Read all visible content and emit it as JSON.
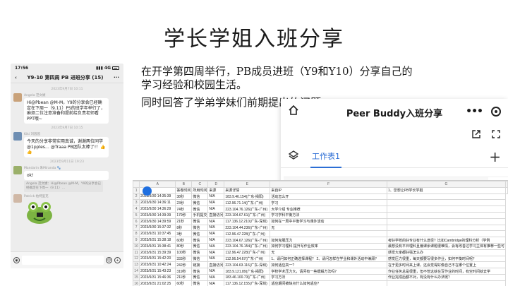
{
  "slide": {
    "title": "学长学姐入班分享",
    "paragraphs": [
      "在开学第四周举行，PB成员进班（Y9和Y10）分享自己的学习经验和校园生活。",
      "同时回答了学弟学妹们前期提出的问题"
    ]
  },
  "phone": {
    "time": "17:56",
    "signal": "4G",
    "chat_title": "Y9-10 第四周 PB 进班分享 (15)",
    "messages": [
      {
        "type": "time",
        "text": "2023年9月7日 10:11"
      },
      {
        "type": "msg",
        "sender": "Angela 范文婕",
        "avatar_color": "#c9a27a",
        "text": "Hi@Pbean @M-M，Y9的分享会已经确定在下周一（9.11）PS的班学年举行了，麻烦二位注意准备和提前给负责老师看PPT哦~"
      },
      {
        "type": "time",
        "text": "2023年9月7日 10:15"
      },
      {
        "type": "msg",
        "sender": "Kiki 刘茵茵",
        "avatar_color": "#6f8fb3",
        "text": "今天的分享非常实用真诚，谢谢两位同学@1pples… @Traaa PB团队太棒了!！👍👍"
      },
      {
        "type": "time",
        "text": "2023年9月11日 19:23"
      },
      {
        "type": "msg",
        "sender": "Mandarin 朱Miranda 🐾",
        "avatar_color": "#9bb06a",
        "text": "ok!",
        "quote": "Angela 范文婕：Hi@Pbean @M-M，Y9的分享会已经确定在下周一（9.11）…"
      },
      {
        "type": "sticker",
        "sender": "Patrick 帕特里克",
        "avatar_color": "#d0b8a6"
      }
    ],
    "input_placeholder": ""
  },
  "app": {
    "title": "Peer Buddy入班分享",
    "more_icon": "more-horizontal-icon",
    "sheet_tab": "工作表1",
    "accent": "#2c6ed5"
  },
  "sheet": {
    "columns": [
      "A",
      "B",
      "C",
      "D",
      "E",
      "F",
      "G"
    ],
    "header_row": [
      "",
      "答卷时间",
      "所用时间",
      "来源",
      "来源详情",
      "来自IP",
      "1、您想让PB学长学姐"
    ],
    "rows": [
      [
        "2",
        "2023/9/30 14:35:39",
        "38秒",
        "微信",
        "N/A",
        "183.9.46.154(广东-揭阳)",
        "活动怎么开"
      ],
      [
        "3",
        "2023/9/30 14:36:11",
        "23秒",
        "微信",
        "N/A",
        "112.96.71.14(广东-广州)",
        "学习"
      ],
      [
        "4",
        "2023/9/30 14:36:29",
        "74秒",
        "微信",
        "N/A",
        "223.104.76.126(广东-广州)",
        "大学介绍 专业推荐"
      ],
      [
        "5",
        "2023/9/30 14:39:39",
        "179秒",
        "手机提交",
        "直接访问",
        "223.104.67.61(广东-广州)",
        "学习学科平衡方法"
      ],
      [
        "6",
        "2023/9/30 14:39:59",
        "21秒",
        "微信",
        "N/A",
        "117.136.12.210(广东-深圳)",
        "如何在一周中平衡学习与课外活动"
      ],
      [
        "7",
        "2023/9/30 15:37:32",
        "8秒",
        "微信",
        "N/A",
        "223.104.44.236(广东-广州)",
        "无"
      ],
      [
        "8",
        "2023/9/31 10:37:45",
        "3秒",
        "微信",
        "N/A",
        "112.96.47.228(广东-广州)",
        ""
      ],
      [
        "9",
        "2023/9/31 15:38:18",
        "60秒",
        "微信",
        "N/A",
        "223.104.67.126(广东-广州)",
        "如何克服压力"
      ],
      [
        "10",
        "2023/9/31 15:38:41",
        "80秒",
        "微信",
        "N/A",
        "223.104.76.154(广东-广州)",
        "如何学习理科 提升写作业效率"
      ],
      [
        "11",
        "2023/9/31 15:39:39",
        "100秒",
        "微信",
        "N/A",
        "112.96.47.228(广东-广州)",
        "无"
      ],
      [
        "12",
        "2023/9/31 15:42:20",
        "333秒",
        "微信",
        "N/A",
        "112.96.54.67(广东-广州)",
        "1、请问如何正确选择课程？ 2、请问怎样在学业和课外活动中兼顾？"
      ],
      [
        "13",
        "2023/9/31 10:42:24",
        "242秒",
        "链接",
        "直接访问",
        "223.104.63.116(广东-深圳)",
        "如何适应高一?"
      ],
      [
        "14",
        "2023/9/31 15:43:23",
        "319秒",
        "微信",
        "N/A",
        "183.9.121.89(广东-揭阳)",
        "学校学术压力大，请问有一些缓解方法吗？"
      ],
      [
        "15",
        "2023/9/31 15:46:36",
        "211秒",
        "微信",
        "N/A",
        "183.46.100.73(广东-广州)",
        "学习方法"
      ],
      [
        "16",
        "2023/9/31 21:02:25",
        "60秒",
        "微信",
        "N/A",
        "117.136.12.155(广东-深圳)",
        "适应期间被缺点什么如何适应?"
      ]
    ],
    "extra_notes": [
      "考好学校的好专业有什么途径？比如Cambridge的理科分析（学例",
      "最想没有平日理科且偏课余课题很难情，会有改善过学习主体有推荐一些可",
      "感觉大家都好强怎么办",
      "感觉压力很重，每天都要写很多作业，如何平衡时间呢？",
      "在于更多时间来上课，还会觉得好像自己不在哪个位置上",
      "作业任务总是很重，但不管这就在写作业的时间，有空时间就去学",
      "作业完成后都不对，有没有什么办法呢？"
    ]
  }
}
